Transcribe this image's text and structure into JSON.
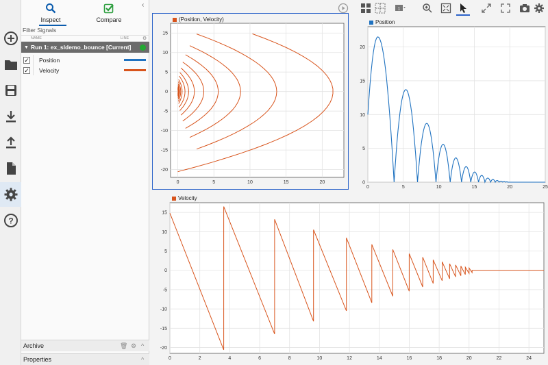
{
  "panel": {
    "tab_inspect": "Inspect",
    "tab_compare": "Compare",
    "filter_label": "Filter Signals",
    "col_name": "NAME",
    "col_line": "LINE",
    "run_label": "Run 1: ex_sldemo_bounce [Current]",
    "signals": [
      {
        "name": "Position",
        "checked": "✓",
        "color": "#1f72c0"
      },
      {
        "name": "Velocity",
        "checked": "✓",
        "color": "#d8541c"
      }
    ],
    "archive_label": "Archive",
    "properties_label": "Properties"
  },
  "rail_icons": [
    "add-icon",
    "folder-icon",
    "save-icon",
    "download-icon",
    "upload-icon",
    "document-icon",
    "gear-icon",
    "help-icon"
  ],
  "colors": {
    "position": "#1f72c0",
    "velocity": "#d8541c",
    "active_border": "#2a62c9"
  },
  "chart_data": [
    {
      "type": "line",
      "legend": "(Position, Velocity)",
      "xlim": [
        -1,
        23
      ],
      "ylim": [
        -22,
        17.5
      ],
      "x_ticks": [
        0,
        5,
        10,
        15,
        20
      ],
      "y_ticks": [
        -20,
        -15,
        -10,
        -5,
        0,
        5,
        10,
        15
      ],
      "description_series": "phase plot of velocity vs position",
      "grid": true
    },
    {
      "type": "line",
      "legend": "Position",
      "xlim": [
        0,
        25
      ],
      "ylim": [
        0,
        23
      ],
      "x_ticks": [
        0,
        5,
        10,
        15,
        20,
        25
      ],
      "y_ticks": [
        0,
        5,
        10,
        15,
        20
      ],
      "bounces": [
        {
          "t0": 0,
          "t1": 3.7,
          "peak_t": 1.4,
          "peak": 21.5,
          "start": 10
        },
        {
          "t0": 3.7,
          "t1": 7.0,
          "peak_t": 5.35,
          "peak": 13.7
        },
        {
          "t0": 7.0,
          "t1": 9.6,
          "peak_t": 8.3,
          "peak": 8.7
        },
        {
          "t0": 9.6,
          "t1": 11.6,
          "peak_t": 10.6,
          "peak": 5.6
        },
        {
          "t0": 11.6,
          "t1": 13.2,
          "peak_t": 12.4,
          "peak": 3.6
        },
        {
          "t0": 13.2,
          "t1": 14.5,
          "peak_t": 13.85,
          "peak": 2.3
        },
        {
          "t0": 14.5,
          "t1": 15.6,
          "peak_t": 15.05,
          "peak": 1.5
        },
        {
          "t0": 15.6,
          "t1": 16.5,
          "peak_t": 16.05,
          "peak": 1.0
        },
        {
          "t0": 16.5,
          "t1": 17.3,
          "peak_t": 16.9,
          "peak": 0.6
        },
        {
          "t0": 17.3,
          "t1": 17.95,
          "peak_t": 17.62,
          "peak": 0.4
        },
        {
          "t0": 17.95,
          "t1": 18.5,
          "peak_t": 18.22,
          "peak": 0.25
        },
        {
          "t0": 18.5,
          "t1": 19.0,
          "peak_t": 18.75,
          "peak": 0.15
        },
        {
          "t0": 19.0,
          "t1": 19.4,
          "peak_t": 19.2,
          "peak": 0.08
        },
        {
          "t0": 19.4,
          "t1": 19.75,
          "peak_t": 19.57,
          "peak": 0.04
        }
      ],
      "grid": true
    },
    {
      "type": "line",
      "legend": "Velocity",
      "xlim": [
        0,
        25
      ],
      "ylim": [
        -21.5,
        17.5
      ],
      "x_ticks": [
        0,
        2,
        4,
        6,
        8,
        10,
        12,
        14,
        16,
        18,
        20,
        22,
        24
      ],
      "y_ticks": [
        -20,
        -15,
        -10,
        -5,
        0,
        5,
        10,
        15
      ],
      "segments": [
        {
          "t0": 0,
          "t1": 3.6,
          "v0": 14.8,
          "v1": -20.6
        },
        {
          "t0": 3.6,
          "t1": 7.0,
          "v0": 16.5,
          "v1": -16.5
        },
        {
          "t0": 7.0,
          "t1": 9.6,
          "v0": 13.2,
          "v1": -13.2
        },
        {
          "t0": 9.6,
          "t1": 11.8,
          "v0": 10.5,
          "v1": -10.5
        },
        {
          "t0": 11.8,
          "t1": 13.5,
          "v0": 8.4,
          "v1": -8.4
        },
        {
          "t0": 13.5,
          "t1": 14.9,
          "v0": 6.7,
          "v1": -6.7
        },
        {
          "t0": 14.9,
          "t1": 16.0,
          "v0": 5.4,
          "v1": -5.4
        },
        {
          "t0": 16.0,
          "t1": 16.9,
          "v0": 4.3,
          "v1": -4.3
        },
        {
          "t0": 16.9,
          "t1": 17.6,
          "v0": 3.4,
          "v1": -3.4
        },
        {
          "t0": 17.6,
          "t1": 18.2,
          "v0": 2.7,
          "v1": -2.7
        },
        {
          "t0": 18.2,
          "t1": 18.7,
          "v0": 2.2,
          "v1": -2.2
        },
        {
          "t0": 18.7,
          "t1": 19.1,
          "v0": 1.7,
          "v1": -1.7
        },
        {
          "t0": 19.1,
          "t1": 19.45,
          "v0": 1.4,
          "v1": -1.4
        },
        {
          "t0": 19.45,
          "t1": 19.75,
          "v0": 1.1,
          "v1": -1.1
        },
        {
          "t0": 19.75,
          "t1": 20.0,
          "v0": 0.8,
          "v1": -0.8
        },
        {
          "t0": 20.0,
          "t1": 20.2,
          "v0": 0.6,
          "v1": -0.6
        },
        {
          "t0": 20.2,
          "t1": 25,
          "v0": 0,
          "v1": 0
        }
      ],
      "grid": true
    }
  ]
}
